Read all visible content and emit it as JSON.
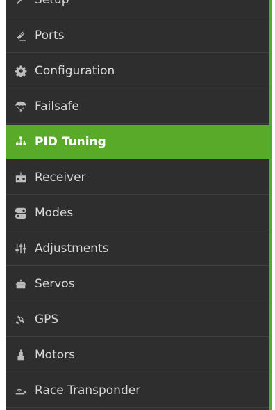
{
  "sidebar": {
    "accent_color": "#59aa29",
    "background_color": "#2e2e2e",
    "items": [
      {
        "label": "Setup",
        "icon": "wrench-icon"
      },
      {
        "label": "Ports",
        "icon": "plug-icon"
      },
      {
        "label": "Configuration",
        "icon": "gear-icon"
      },
      {
        "label": "Failsafe",
        "icon": "parachute-icon"
      },
      {
        "label": "PID Tuning",
        "icon": "sitemap-icon",
        "active": true
      },
      {
        "label": "Receiver",
        "icon": "receiver-icon"
      },
      {
        "label": "Modes",
        "icon": "toggle-icon"
      },
      {
        "label": "Adjustments",
        "icon": "sliders-icon"
      },
      {
        "label": "Servos",
        "icon": "servo-icon"
      },
      {
        "label": "GPS",
        "icon": "satellite-icon"
      },
      {
        "label": "Motors",
        "icon": "motor-icon"
      },
      {
        "label": "Race Transponder",
        "icon": "transponder-icon"
      }
    ]
  }
}
